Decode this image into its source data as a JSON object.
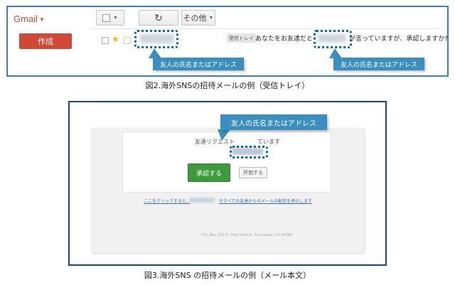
{
  "figure2": {
    "gmail": {
      "logo": "Gmail",
      "compose_label": "作成",
      "more_label": "その他",
      "inbox_tag": "受信トレイ",
      "subject_before": "あなたをお友達だと",
      "subject_after": "が言っていますが、承認しますか?"
    },
    "callout_sender": "友人の氏名またはアドレス",
    "callout_subject": "友人の氏名またはアドレス",
    "caption": "図2.海外SNSの招待メールの例（受信トレイ）"
  },
  "figure3": {
    "request_text": "友達リクエスト　　　　ています",
    "accept_label": "承認する",
    "defer_label": "評価する",
    "callout": "友人の氏名またはアドレス",
    "link_start": "ここをクリックすると、",
    "link_end": "やすべての友達からのメールの配信を停止します",
    "address": "P.O. Box 10273, Palo Station, Sunnyvale, CA 94088",
    "caption": "図3.海外SNS の招待メールの例（メール本文）"
  },
  "icons": {
    "refresh": "refresh-icon",
    "star": "star-icon",
    "dropdown": "chevron-down-icon"
  },
  "colors": {
    "gmail_red": "#d14836",
    "callout_blue": "#3a8fbf",
    "frame_blue": "#3e7fbe",
    "frame_navy": "#22446a",
    "accept_green": "#3f9a3d"
  }
}
